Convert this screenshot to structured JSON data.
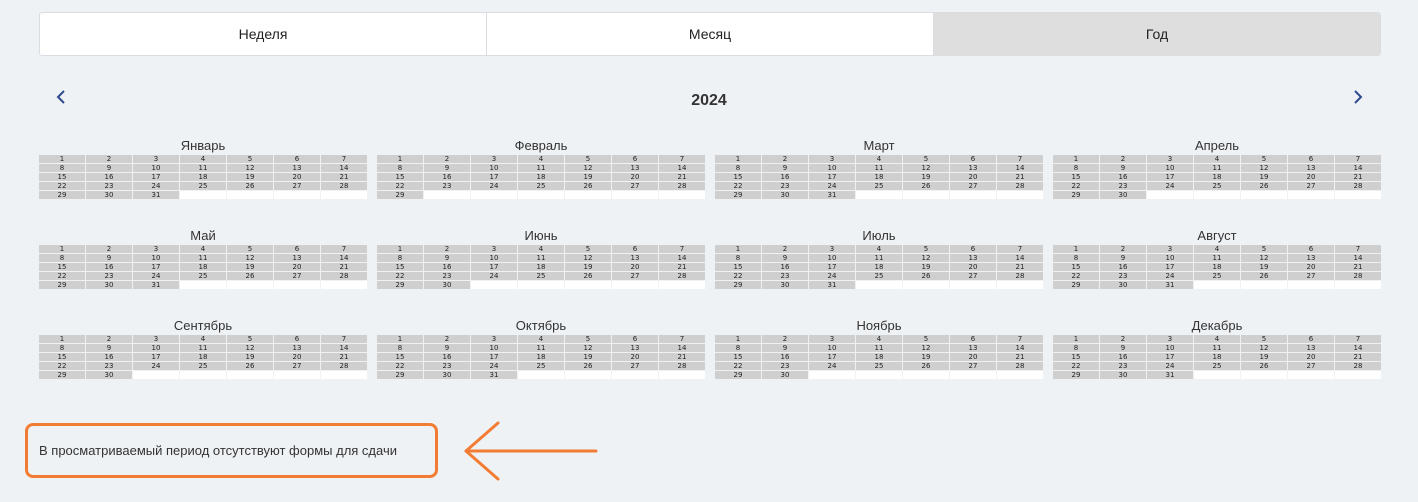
{
  "tabs": [
    {
      "label": "Неделя",
      "active": false
    },
    {
      "label": "Месяц",
      "active": false
    },
    {
      "label": "Год",
      "active": true
    }
  ],
  "year": "2024",
  "nav": {
    "prev_icon": "chevron-left-icon",
    "next_icon": "chevron-right-icon"
  },
  "months": [
    {
      "name": "Январь",
      "days": 31
    },
    {
      "name": "Февраль",
      "days": 29
    },
    {
      "name": "Март",
      "days": 31
    },
    {
      "name": "Апрель",
      "days": 30
    },
    {
      "name": "Май",
      "days": 31
    },
    {
      "name": "Июнь",
      "days": 30
    },
    {
      "name": "Июль",
      "days": 31
    },
    {
      "name": "Август",
      "days": 31
    },
    {
      "name": "Сентябрь",
      "days": 30
    },
    {
      "name": "Октябрь",
      "days": 31
    },
    {
      "name": "Ноябрь",
      "days": 30
    },
    {
      "name": "Декабрь",
      "days": 31
    }
  ],
  "message": "В просматриваемый период отсутствуют формы для сдачи",
  "colors": {
    "highlight": "#f37c34",
    "nav": "#2d4a8c",
    "active_tab": "#dedede",
    "day_cell": "#cfcfcf"
  }
}
